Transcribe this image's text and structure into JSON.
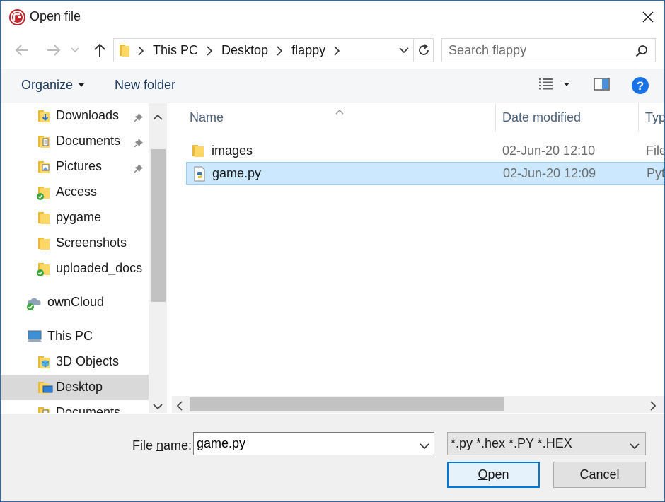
{
  "window": {
    "title": "Open file"
  },
  "address": {
    "crumbs": [
      "This PC",
      "Desktop",
      "flappy"
    ],
    "search_placeholder": "Search flappy"
  },
  "toolbar": {
    "organize_label": "Organize",
    "new_folder_label": "New folder"
  },
  "nav": {
    "items": [
      {
        "label": "Downloads",
        "pinned": true
      },
      {
        "label": "Documents",
        "pinned": true
      },
      {
        "label": "Pictures",
        "pinned": true
      },
      {
        "label": "Access",
        "pinned": false
      },
      {
        "label": "pygame",
        "pinned": false
      },
      {
        "label": "Screenshots",
        "pinned": false
      },
      {
        "label": "uploaded_docs",
        "pinned": false
      },
      {
        "label": "ownCloud",
        "pinned": false
      },
      {
        "label": "This PC",
        "pinned": false
      },
      {
        "label": "3D Objects",
        "pinned": false
      },
      {
        "label": "Desktop",
        "pinned": false,
        "selected": true
      },
      {
        "label": "Documents",
        "pinned": false
      }
    ]
  },
  "files": {
    "columns": [
      "Name",
      "Date modified",
      "Typ"
    ],
    "rows": [
      {
        "name": "images",
        "date": "02-Jun-20 12:10",
        "type": "File"
      },
      {
        "name": "game.py",
        "date": "02-Jun-20 12:09",
        "type": "Pytl",
        "selected": true
      }
    ]
  },
  "bottom": {
    "file_name_label_pre": "File ",
    "file_name_label_u": "n",
    "file_name_label_post": "ame:",
    "file_name_value": "game.py",
    "file_type_value": "*.py *.hex *.PY *.HEX",
    "open_label_u": "O",
    "open_label_rest": "pen",
    "cancel_label": "Cancel"
  },
  "colors": {
    "accent": "#0078d7",
    "selection": "#cce8ff",
    "help": "#1a73e8"
  }
}
